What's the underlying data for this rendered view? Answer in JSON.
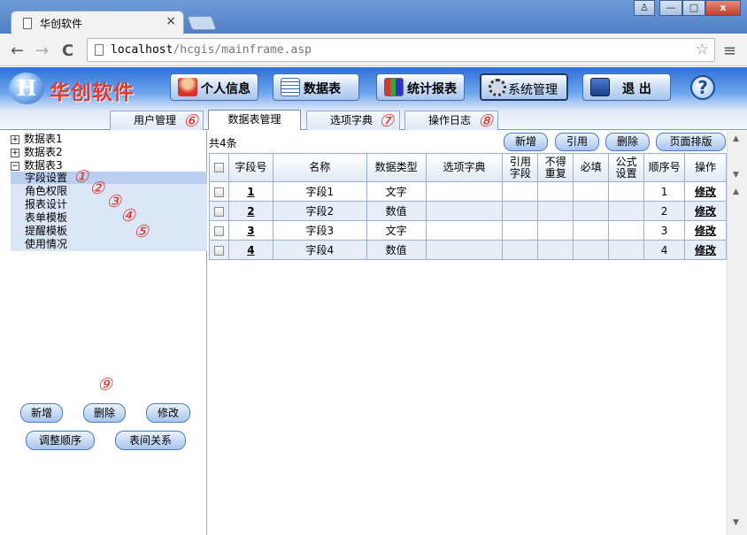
{
  "browser": {
    "tab_title": "华创软件",
    "tab_close": "×",
    "url_host": "localhost",
    "url_path": "/hcgis/mainframe.asp",
    "back": "←",
    "forward": "→",
    "reload": "C",
    "star": "☆",
    "menu": "≡",
    "win_user": "♙",
    "win_min": "—",
    "win_max": "□",
    "win_close": "x"
  },
  "app": {
    "logo_glyph": "H",
    "brand": "华创软件",
    "help": "?",
    "nav": [
      {
        "label": "个人信息",
        "icon": "person-icon"
      },
      {
        "label": "数据表",
        "icon": "table-icon"
      },
      {
        "label": "统计报表",
        "icon": "chart-icon"
      },
      {
        "label": "系统管理",
        "icon": "gear-icon"
      },
      {
        "label": "退 出",
        "icon": "exit-icon"
      }
    ]
  },
  "tabs": [
    {
      "label": "用户管理",
      "badge": "⑥"
    },
    {
      "label": "数据表管理",
      "badge": ""
    },
    {
      "label": "选项字典",
      "badge": "⑦"
    },
    {
      "label": "操作日志",
      "badge": "⑧"
    }
  ],
  "tree": {
    "items": [
      {
        "toggle": "+",
        "label": "数据表1"
      },
      {
        "toggle": "+",
        "label": "数据表2"
      },
      {
        "toggle": "−",
        "label": "数据表3"
      }
    ],
    "children": [
      {
        "label": "字段设置",
        "badge": "①"
      },
      {
        "label": "角色权限",
        "badge": "②"
      },
      {
        "label": "报表设计",
        "badge": "③"
      },
      {
        "label": "表单模板",
        "badge": "④"
      },
      {
        "label": "提醒模板",
        "badge": "⑤"
      },
      {
        "label": "使用情况",
        "badge": ""
      }
    ],
    "badge9": "⑨",
    "buttons": {
      "add": "新增",
      "delete": "删除",
      "edit": "修改",
      "reorder": "调整顺序",
      "relations": "表间关系"
    }
  },
  "grid": {
    "count_text": "共4条",
    "buttons": {
      "add": "新增",
      "cite": "引用",
      "delete": "删除",
      "layout": "页面排版"
    },
    "headers": {
      "field_no": "字段号",
      "name": "名称",
      "data_type": "数据类型",
      "dict": "选项字典",
      "cite_field_1": "引用",
      "cite_field_2": "字段",
      "unique_1": "不得",
      "unique_2": "重复",
      "required": "必填",
      "formula_1": "公式",
      "formula_2": "设置",
      "order": "顺序号",
      "action": "操作"
    },
    "rows": [
      {
        "no": "1",
        "name": "字段1",
        "type": "文字",
        "dict": "",
        "cite": "",
        "unique": "",
        "required": "",
        "formula": "",
        "order": "1",
        "action": "修改"
      },
      {
        "no": "2",
        "name": "字段2",
        "type": "数值",
        "dict": "",
        "cite": "",
        "unique": "",
        "required": "",
        "formula": "",
        "order": "2",
        "action": "修改"
      },
      {
        "no": "3",
        "name": "字段3",
        "type": "文字",
        "dict": "",
        "cite": "",
        "unique": "",
        "required": "",
        "formula": "",
        "order": "3",
        "action": "修改"
      },
      {
        "no": "4",
        "name": "字段4",
        "type": "数值",
        "dict": "",
        "cite": "",
        "unique": "",
        "required": "",
        "formula": "",
        "order": "4",
        "action": "修改"
      }
    ]
  }
}
